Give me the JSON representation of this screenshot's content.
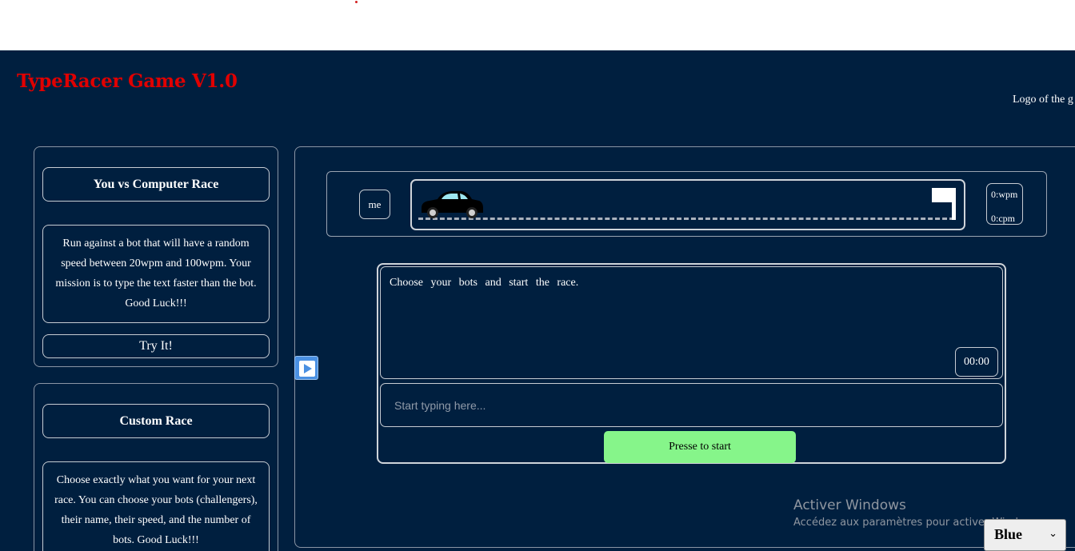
{
  "header": {
    "title": "TypeRacer Game V1.0",
    "logo_alt": "Logo of the g"
  },
  "cards": [
    {
      "title": "You vs Computer Race",
      "description": "Run against a bot that will have a random speed between 20wpm and 100wpm. Your mission is to type the text faster than the bot. Good Luck!!!",
      "button": "Try It!"
    },
    {
      "title": "Custom Race",
      "description": "Choose exactly what you want for your next race. You can choose your bots (challengers), their name, their speed, and the number of bots. Good Luck!!!"
    }
  ],
  "race": {
    "player_label": "me",
    "wpm": "0:wpm",
    "cpm": "0:cpm",
    "progress": 0
  },
  "typing": {
    "text": "Choose your bots and start the race.",
    "timer": "00:00",
    "input_placeholder": "Start typing here...",
    "start_button": "Presse to start"
  },
  "watermark": {
    "title": "Activer Windows",
    "subtitle": "Accédez aux paramètres pour activer Windows."
  },
  "theme_select": {
    "value": "Blue"
  },
  "icons": [
    "play-icon",
    "car-icon",
    "finish-flag-icon",
    "chevron-down-icon"
  ],
  "colors": {
    "background": "#001f3f",
    "title": "#e00000",
    "start_button": "#86f58a",
    "play_button": "#4a90e2"
  }
}
